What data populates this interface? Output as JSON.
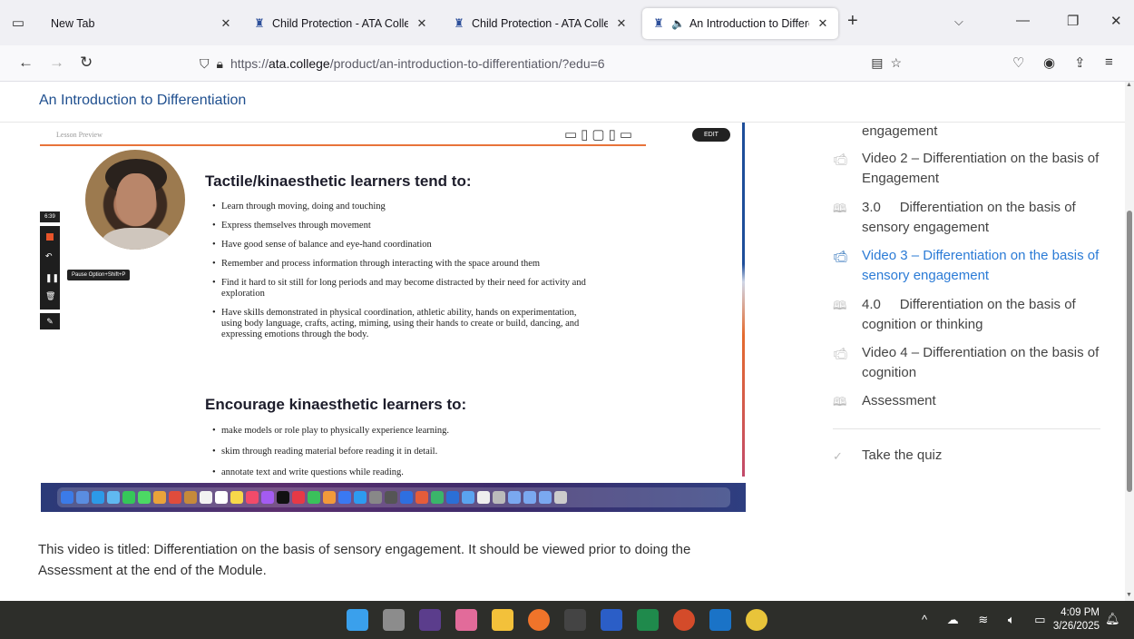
{
  "browser": {
    "tabs": [
      {
        "label": "New Tab"
      },
      {
        "label": "Child Protection - ATA College"
      },
      {
        "label": "Child Protection - ATA College"
      },
      {
        "label": "An Introduction to Differenti"
      }
    ],
    "url_prefix": "https://",
    "url_domain": "ata.college",
    "url_path": "/product/an-introduction-to-differentiation/?edu=6"
  },
  "page": {
    "title": "An Introduction to Differentiation",
    "caption": "This video is titled: Differentiation on the basis of sensory engagement. It should be viewed prior to doing the Assessment at the end of the Module."
  },
  "video": {
    "lesson_preview": "Lesson Preview",
    "edit_label": "EDIT",
    "timer": "6:39",
    "pause_tooltip": "Pause Option+Shift+P",
    "heading1": "Tactile/kinaesthetic learners tend to:",
    "bullets1": [
      "Learn through moving, doing and touching",
      "Express themselves through movement",
      "Have good sense of balance and eye-hand coordination",
      "Remember and process information through interacting with the space around them",
      "Find it hard to sit still for long periods and may become distracted by their need for activity and exploration",
      "Have skills demonstrated in physical coordination, athletic ability, hands on experimentation, using body language, crafts, acting, miming, using their hands to create or build, dancing, and expressing emotions through the body."
    ],
    "heading2": "Encourage kinaesthetic learners to:",
    "bullets2": [
      "make models or role play to physically experience learning.",
      "skim through reading material before reading it in detail.",
      "annotate text and write questions while reading."
    ]
  },
  "sidebar": {
    "items": [
      {
        "icon": "video-icon",
        "label": "engagement"
      },
      {
        "icon": "video-icon",
        "label": "Video 2 – Differentiation on the basis of Engagement"
      },
      {
        "icon": "book-icon",
        "label": "3.0     Differentiation on the basis of sensory engagement"
      },
      {
        "icon": "video-icon",
        "label": "Video 3 – Differentiation on the basis of sensory engagement",
        "active": true
      },
      {
        "icon": "book-icon",
        "label": "4.0     Differentiation on the basis of cognition or thinking"
      },
      {
        "icon": "video-icon",
        "label": "Video 4 – Differentiation on the basis of cognition"
      },
      {
        "icon": "book-icon",
        "label": "Assessment"
      }
    ],
    "quiz_label": "Take the quiz"
  },
  "taskbar": {
    "time": "4:09 PM",
    "date": "3/26/2025"
  },
  "colors": {
    "accent": "#2b7bd6",
    "title_blue": "#1f4f8f",
    "orange": "#e8733a"
  }
}
